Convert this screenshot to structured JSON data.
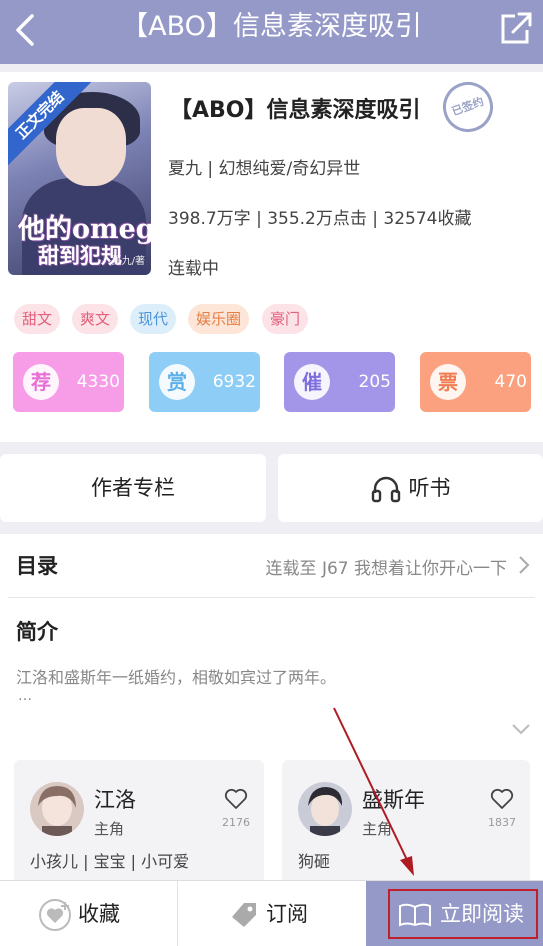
{
  "topbar": {
    "title": "【ABO】信息素深度吸引",
    "back_icon": "chevron-left-icon",
    "share_icon": "share-icon",
    "color": "#9599c8"
  },
  "book": {
    "cover": {
      "band": "正文完结",
      "caption_line1": "他的omega",
      "caption_line2": "甜到犯规",
      "author_mark": "夏九/著"
    },
    "title": "【ABO】信息素深度吸引",
    "signed_badge": "已签约",
    "author_genre": "夏九 | 幻想纯爱/奇幻异世",
    "stats_line": "398.7万字 | 355.2万点击 | 32574收藏",
    "status": "连载中"
  },
  "tags": [
    {
      "label": "甜文",
      "bg": "#fbe3e8",
      "fg": "#e2607a"
    },
    {
      "label": "爽文",
      "bg": "#fbe3e8",
      "fg": "#e2607a"
    },
    {
      "label": "现代",
      "bg": "#ddeefb",
      "fg": "#4a93d9"
    },
    {
      "label": "娱乐圈",
      "bg": "#fde6d8",
      "fg": "#e57e45"
    },
    {
      "label": "豪门",
      "bg": "#fbe3e8",
      "fg": "#e2607a"
    }
  ],
  "stat_buttons": [
    {
      "icon_char": "荐",
      "value": "4330",
      "color": "#f79de8",
      "icon_color": "#e86fd4"
    },
    {
      "icon_char": "赏",
      "value": "6932",
      "color": "#8ecdf5",
      "icon_color": "#5bb0ea"
    },
    {
      "icon_char": "催",
      "value": "205",
      "color": "#a396e8",
      "icon_color": "#7f6fde"
    },
    {
      "icon_char": "票",
      "value": "470",
      "color": "#fba17f",
      "icon_color": "#f27d52"
    }
  ],
  "actions": {
    "author_column": "作者专栏",
    "listen": "听书"
  },
  "toc": {
    "label": "目录",
    "latest": "连载至 J67 我想着让你开心一下"
  },
  "intro": {
    "label": "简介",
    "text": "江洛和盛斯年一纸婚约，相敬如宾过了两年。",
    "ellipsis": "…"
  },
  "characters": [
    {
      "name": "江洛",
      "role": "主角",
      "likes": "2176",
      "tags": "小孩儿 | 宝宝 | 小可爱"
    },
    {
      "name": "盛斯年",
      "role": "主角",
      "likes": "1837",
      "tags": "狗砸"
    }
  ],
  "bottom": {
    "favorite": "收藏",
    "subscribe": "订阅",
    "read_now": "立即阅读"
  }
}
